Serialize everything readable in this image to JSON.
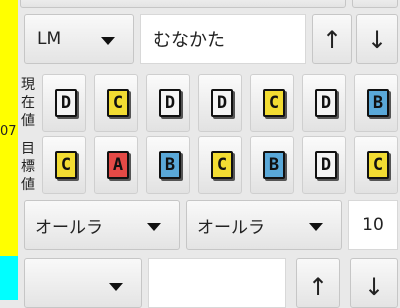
{
  "colors": {
    "stripe_top": "#ffff00",
    "stripe_bottom": "#00ffff",
    "tile_white": "#f4f4f4",
    "tile_yellow": "#f2dc32",
    "tile_red": "#e44a46",
    "tile_blue": "#5aa8d8"
  },
  "row1": {
    "select_value": "LM",
    "name_value": "むなかた",
    "up_icon": "↑",
    "down_icon": "↓"
  },
  "side_number": "07",
  "label_current": [
    "現",
    "在",
    "値"
  ],
  "label_target": [
    "目",
    "標",
    "値"
  ],
  "current_tiles": [
    {
      "letter": "D",
      "color": "white"
    },
    {
      "letter": "C",
      "color": "yellow"
    },
    {
      "letter": "D",
      "color": "white"
    },
    {
      "letter": "D",
      "color": "white"
    },
    {
      "letter": "C",
      "color": "yellow"
    },
    {
      "letter": "D",
      "color": "white"
    },
    {
      "letter": "B",
      "color": "blue"
    }
  ],
  "target_tiles": [
    {
      "letter": "C",
      "color": "yellow"
    },
    {
      "letter": "A",
      "color": "red"
    },
    {
      "letter": "B",
      "color": "blue"
    },
    {
      "letter": "C",
      "color": "yellow"
    },
    {
      "letter": "B",
      "color": "blue"
    },
    {
      "letter": "D",
      "color": "white"
    },
    {
      "letter": "C",
      "color": "yellow"
    }
  ],
  "row4": {
    "select1_value": "オールラ",
    "select2_value": "オールラ",
    "number_value": "10"
  },
  "row5": {
    "select_value": "",
    "input_value": "",
    "up_icon": "↑",
    "down_icon": "↓"
  }
}
